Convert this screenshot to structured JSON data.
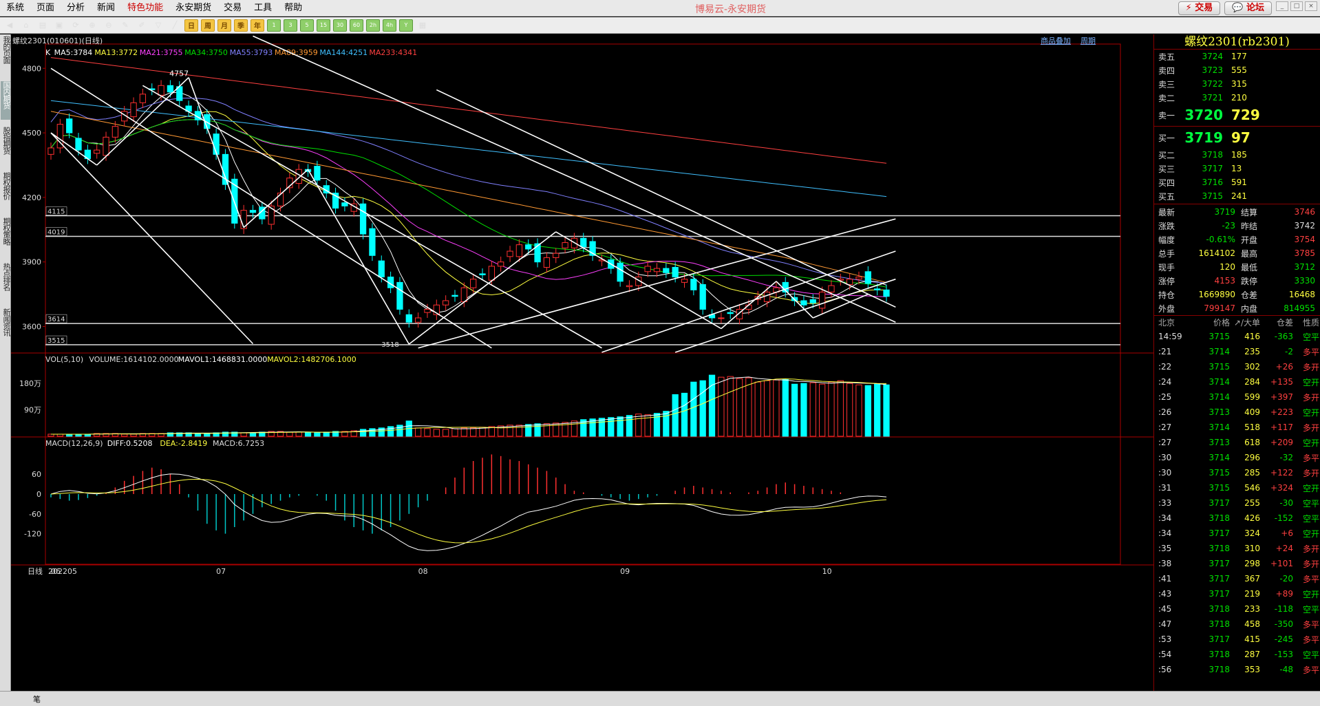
{
  "menu": [
    "系统",
    "页面",
    "分析",
    "新闻",
    "特色功能",
    "永安期货",
    "交易",
    "工具",
    "帮助"
  ],
  "app_title": "博易云-永安期货",
  "top_buttons": {
    "trade": "⚡ 交易",
    "forum": "💬 论坛"
  },
  "left_tabs": [
    "我的页面",
    "国内期货",
    "股指期货",
    "期权报价",
    "期权策略",
    "热点排名",
    "新闻资讯"
  ],
  "chart_header": {
    "title": "螺纹2301(010601)(日线)",
    "links": [
      "商品叠加",
      "周期"
    ]
  },
  "ma_legend": [
    {
      "text": "K",
      "color": "#ffffff"
    },
    {
      "text": "MA5:3784",
      "color": "#ffffff"
    },
    {
      "text": "MA13:3772",
      "color": "#ffff40"
    },
    {
      "text": "MA21:3755",
      "color": "#ff40ff"
    },
    {
      "text": "MA34:3750",
      "color": "#00e000"
    },
    {
      "text": "MA55:3793",
      "color": "#8080ff"
    },
    {
      "text": "MA89:3959",
      "color": "#ff9933"
    },
    {
      "text": "MA144:4251",
      "color": "#40c0ff"
    },
    {
      "text": "MA233:4341",
      "color": "#ff4040"
    }
  ],
  "price_axis": [
    "4800",
    "4500",
    "4200",
    "3900",
    "3600"
  ],
  "h_levels": [
    "4115",
    "4019",
    "3614",
    "3515"
  ],
  "peak_label": "4757",
  "low_label": "3518",
  "vol_header": {
    "name": "VOL(5,10)",
    "volume": "VOLUME:1614102.0000",
    "mavol1": "MAVOL1:1468831.0000",
    "mavol2": "MAVOL2:1482706.1000"
  },
  "vol_axis": [
    "180万",
    "90万"
  ],
  "macd_header": {
    "name": "MACD(12,26,9)",
    "diff": "DIFF:0.5208",
    "dea": "DEA:-2.8419",
    "macd": "MACD:6.7253"
  },
  "macd_axis": [
    "60",
    "0",
    "-60",
    "-120"
  ],
  "date_axis": [
    "日线",
    "202205",
    "06",
    "07",
    "08",
    "09",
    "10"
  ],
  "quote": {
    "title": "螺纹2301(rb2301)",
    "asks": [
      {
        "label": "卖五",
        "price": "3724",
        "vol": "177"
      },
      {
        "label": "卖四",
        "price": "3723",
        "vol": "555"
      },
      {
        "label": "卖三",
        "price": "3722",
        "vol": "315"
      },
      {
        "label": "卖二",
        "price": "3721",
        "vol": "210"
      },
      {
        "label": "卖一",
        "price": "3720",
        "vol": "729"
      }
    ],
    "bids": [
      {
        "label": "买一",
        "price": "3719",
        "vol": "97"
      },
      {
        "label": "买二",
        "price": "3718",
        "vol": "185"
      },
      {
        "label": "买三",
        "price": "3717",
        "vol": "13"
      },
      {
        "label": "买四",
        "price": "3716",
        "vol": "591"
      },
      {
        "label": "买五",
        "price": "3715",
        "vol": "241"
      }
    ],
    "stats": [
      {
        "a": "最新",
        "b": "3719",
        "bc": "green",
        "c": "结算",
        "d": "3746",
        "dc": "red"
      },
      {
        "a": "涨跌",
        "b": "-23",
        "bc": "green",
        "c": "昨结",
        "d": "3742",
        "dc": "wht"
      },
      {
        "a": "幅度",
        "b": "-0.61%",
        "bc": "green",
        "c": "开盘",
        "d": "3754",
        "dc": "red"
      },
      {
        "a": "总手",
        "b": "1614102",
        "bc": "yel",
        "c": "最高",
        "d": "3785",
        "dc": "red"
      },
      {
        "a": "现手",
        "b": "120",
        "bc": "yel",
        "c": "最低",
        "d": "3712",
        "dc": "green"
      },
      {
        "a": "涨停",
        "b": "4153",
        "bc": "red",
        "c": "跌停",
        "d": "3330",
        "dc": "green"
      },
      {
        "a": "持仓",
        "b": "1669890",
        "bc": "yel",
        "c": "仓差",
        "d": "16468",
        "dc": "yel"
      },
      {
        "a": "外盘",
        "b": "799147",
        "bc": "red",
        "c": "内盘",
        "d": "814955",
        "dc": "green"
      }
    ],
    "tick_header": [
      "北京",
      "价格",
      "↗/大单",
      "仓差",
      "性质"
    ],
    "ticks": [
      {
        "t": "14:59",
        "p": "3715",
        "v": "416",
        "o": "-363",
        "k": "空平",
        "pc": "green",
        "oc": "green",
        "kc": "green"
      },
      {
        "t": ":21",
        "p": "3714",
        "v": "235",
        "o": "-2",
        "k": "多平",
        "pc": "green",
        "oc": "green",
        "kc": "red"
      },
      {
        "t": ":22",
        "p": "3715",
        "v": "302",
        "o": "+26",
        "k": "多开",
        "pc": "green",
        "oc": "red",
        "kc": "red"
      },
      {
        "t": ":24",
        "p": "3714",
        "v": "284",
        "o": "+135",
        "k": "空开",
        "pc": "green",
        "oc": "red",
        "kc": "green"
      },
      {
        "t": ":25",
        "p": "3714",
        "v": "599",
        "o": "+397",
        "k": "多开",
        "pc": "green",
        "oc": "red",
        "kc": "red"
      },
      {
        "t": ":26",
        "p": "3713",
        "v": "409",
        "o": "+223",
        "k": "空开",
        "pc": "green",
        "oc": "red",
        "kc": "green"
      },
      {
        "t": ":27",
        "p": "3714",
        "v": "518",
        "o": "+117",
        "k": "多开",
        "pc": "green",
        "oc": "red",
        "kc": "red"
      },
      {
        "t": ":27",
        "p": "3713",
        "v": "618",
        "o": "+209",
        "k": "空开",
        "pc": "green",
        "oc": "red",
        "kc": "green"
      },
      {
        "t": ":30",
        "p": "3714",
        "v": "296",
        "o": "-32",
        "k": "多平",
        "pc": "green",
        "oc": "green",
        "kc": "red"
      },
      {
        "t": ":30",
        "p": "3715",
        "v": "285",
        "o": "+122",
        "k": "多开",
        "pc": "green",
        "oc": "red",
        "kc": "red"
      },
      {
        "t": ":31",
        "p": "3715",
        "v": "546",
        "o": "+324",
        "k": "空开",
        "pc": "green",
        "oc": "red",
        "kc": "green"
      },
      {
        "t": ":33",
        "p": "3717",
        "v": "255",
        "o": "-30",
        "k": "空平",
        "pc": "green",
        "oc": "green",
        "kc": "green"
      },
      {
        "t": ":34",
        "p": "3718",
        "v": "426",
        "o": "-152",
        "k": "空平",
        "pc": "green",
        "oc": "green",
        "kc": "green"
      },
      {
        "t": ":34",
        "p": "3717",
        "v": "324",
        "o": "+6",
        "k": "空开",
        "pc": "green",
        "oc": "red",
        "kc": "green"
      },
      {
        "t": ":35",
        "p": "3718",
        "v": "310",
        "o": "+24",
        "k": "多开",
        "pc": "green",
        "oc": "red",
        "kc": "red"
      },
      {
        "t": ":38",
        "p": "3717",
        "v": "298",
        "o": "+101",
        "k": "多开",
        "pc": "green",
        "oc": "red",
        "kc": "red"
      },
      {
        "t": ":41",
        "p": "3717",
        "v": "367",
        "o": "-20",
        "k": "多平",
        "pc": "green",
        "oc": "green",
        "kc": "red"
      },
      {
        "t": ":43",
        "p": "3717",
        "v": "219",
        "o": "+89",
        "k": "空开",
        "pc": "green",
        "oc": "red",
        "kc": "green"
      },
      {
        "t": ":45",
        "p": "3718",
        "v": "233",
        "o": "-118",
        "k": "空平",
        "pc": "green",
        "oc": "green",
        "kc": "green"
      },
      {
        "t": ":47",
        "p": "3718",
        "v": "458",
        "o": "-350",
        "k": "多平",
        "pc": "green",
        "oc": "green",
        "kc": "red"
      },
      {
        "t": ":53",
        "p": "3717",
        "v": "415",
        "o": "-245",
        "k": "多平",
        "pc": "green",
        "oc": "green",
        "kc": "red"
      },
      {
        "t": ":54",
        "p": "3718",
        "v": "287",
        "o": "-153",
        "k": "空平",
        "pc": "green",
        "oc": "green",
        "kc": "green"
      },
      {
        "t": ":56",
        "p": "3718",
        "v": "353",
        "o": "-48",
        "k": "多平",
        "pc": "green",
        "oc": "green",
        "kc": "red"
      }
    ]
  },
  "status_left": "笔",
  "chart_data": {
    "type": "candlestick",
    "title": "螺纹2301(010601)(日线)",
    "ylim": [
      3480,
      4900
    ],
    "h_levels": [
      4115,
      4019,
      3614,
      3515
    ],
    "closes": [
      4430,
      4540,
      4500,
      4420,
      4380,
      4420,
      4480,
      4530,
      4600,
      4640,
      4680,
      4700,
      4720,
      4690,
      4650,
      4600,
      4560,
      4520,
      4400,
      4260,
      4080,
      4140,
      4130,
      4100,
      4160,
      4220,
      4290,
      4330,
      4320,
      4280,
      4220,
      4150,
      4160,
      4170,
      4030,
      3930,
      3830,
      3780,
      3680,
      3620,
      3640,
      3680,
      3700,
      3720,
      3740,
      3780,
      3820,
      3840,
      3880,
      3900,
      3950,
      3980,
      3960,
      3900,
      3920,
      3940,
      3990,
      4010,
      3970,
      3930,
      3910,
      3870,
      3810,
      3790,
      3830,
      3880,
      3870,
      3850,
      3830,
      3820,
      3770,
      3680,
      3640,
      3640,
      3660,
      3680,
      3700,
      3740,
      3760,
      3780,
      3760,
      3720,
      3700,
      3710,
      3760,
      3790,
      3820,
      3820,
      3830,
      3800,
      3770,
      3740
    ],
    "volumes": [
      3,
      3,
      3,
      3,
      3,
      4,
      4,
      4,
      3,
      3,
      4,
      4,
      4,
      5,
      5,
      5,
      4,
      4,
      5,
      6,
      6,
      5,
      5,
      6,
      7,
      7,
      6,
      6,
      5,
      5,
      6,
      7,
      7,
      8,
      10,
      11,
      12,
      14,
      16,
      22,
      12,
      11,
      10,
      10,
      11,
      12,
      12,
      13,
      14,
      15,
      16,
      16,
      17,
      18,
      18,
      19,
      20,
      22,
      24,
      25,
      26,
      27,
      28,
      30,
      32,
      31,
      33,
      36,
      60,
      62,
      78,
      80,
      88,
      85,
      86,
      83,
      84,
      78,
      80,
      81,
      82,
      75,
      76,
      77,
      75,
      78,
      80,
      76,
      74,
      73,
      75,
      74
    ],
    "macd": [
      -10,
      -15,
      -20,
      -18,
      -12,
      -5,
      5,
      20,
      40,
      55,
      70,
      80,
      75,
      60,
      30,
      -10,
      -50,
      -90,
      -110,
      -120,
      -100,
      -80,
      -60,
      -40,
      -30,
      -20,
      -10,
      -5,
      0,
      -5,
      -20,
      -50,
      -80,
      -100,
      -110,
      -120,
      -110,
      -100,
      -80,
      -60,
      -40,
      -20,
      0,
      20,
      50,
      80,
      100,
      110,
      120,
      115,
      105,
      100,
      90,
      80,
      70,
      50,
      30,
      10,
      5,
      0,
      -5,
      -10,
      -15,
      -20,
      -15,
      -10,
      -5,
      0,
      10,
      20,
      25,
      20,
      15,
      10,
      5,
      0,
      5,
      10,
      20,
      30,
      35,
      30,
      25,
      20,
      15,
      10,
      5,
      0
    ]
  }
}
